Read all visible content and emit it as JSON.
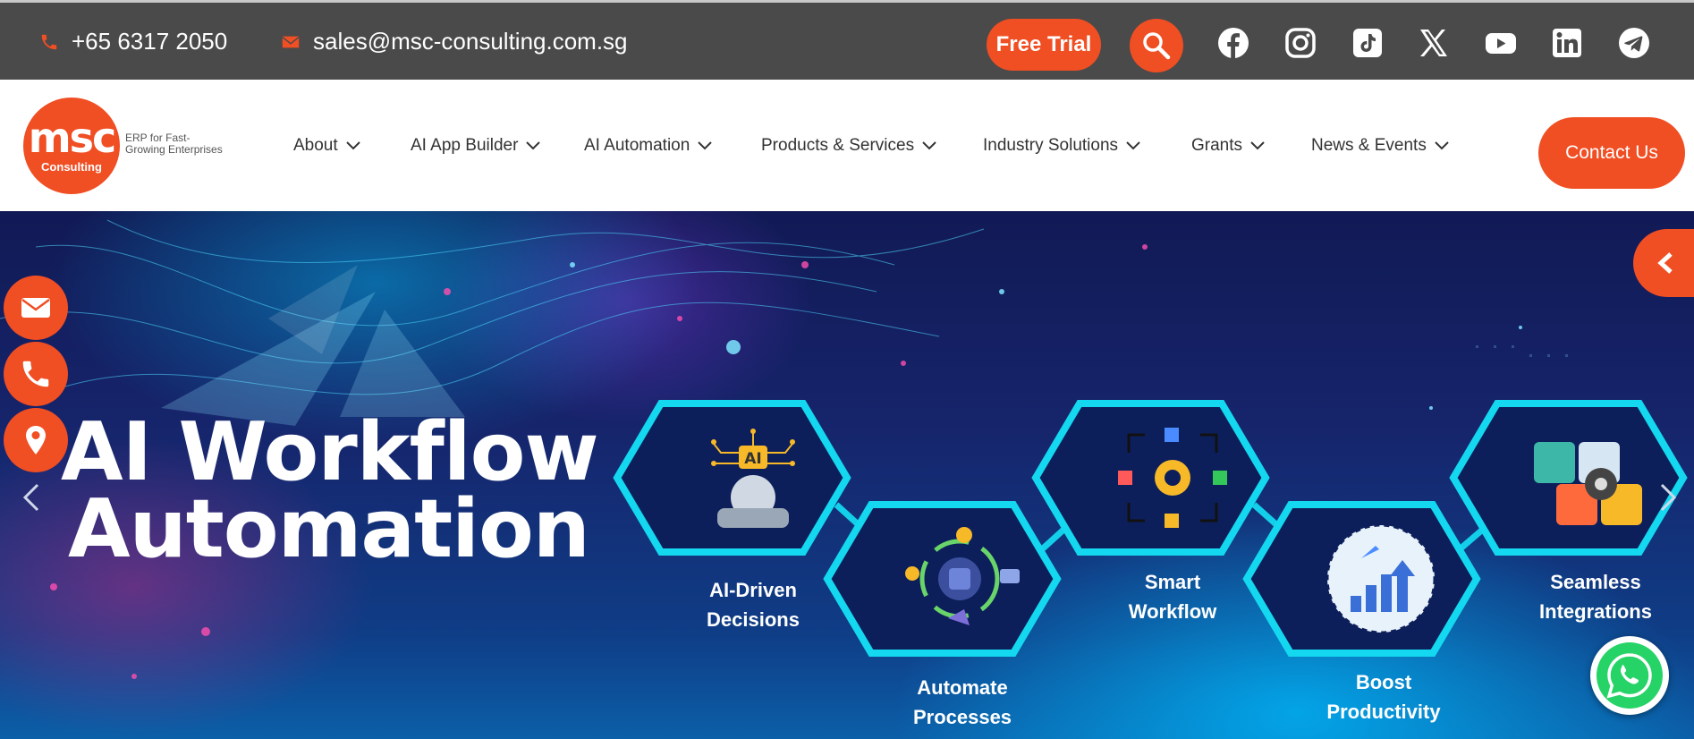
{
  "topbar": {
    "phone": "+65 6317 2050",
    "email": "sales@msc-consulting.com.sg",
    "free_trial": "Free Trial",
    "social": [
      "facebook-icon",
      "instagram-icon",
      "tiktok-icon",
      "x-icon",
      "youtube-icon",
      "linkedin-icon",
      "telegram-icon"
    ]
  },
  "header": {
    "logo_text": "msc",
    "logo_sub": "Consulting",
    "tagline": "ERP for Fast-Growing Enterprises",
    "nav": [
      {
        "label": "About"
      },
      {
        "label": "AI App Builder"
      },
      {
        "label": "AI Automation"
      },
      {
        "label": "Products & Services"
      },
      {
        "label": "Industry Solutions"
      },
      {
        "label": "Grants"
      },
      {
        "label": "News & Events"
      }
    ],
    "contact_us": "Contact Us"
  },
  "hero": {
    "title_line1": "AI Workflow",
    "title_line2": "Automation",
    "features": [
      {
        "line1": "AI-Driven",
        "line2": "Decisions"
      },
      {
        "line1": "Automate",
        "line2": "Processes"
      },
      {
        "line1": "Smart",
        "line2": "Workflow"
      },
      {
        "line1": "Boost",
        "line2": "Productivity"
      },
      {
        "line1": "Seamless",
        "line2": "Integrations"
      }
    ],
    "hex_badge": "AI"
  },
  "colors": {
    "accent": "#f04e23",
    "topbar": "#4a4a4a",
    "hex_stroke": "#14d8f0",
    "whatsapp": "#25d366"
  }
}
